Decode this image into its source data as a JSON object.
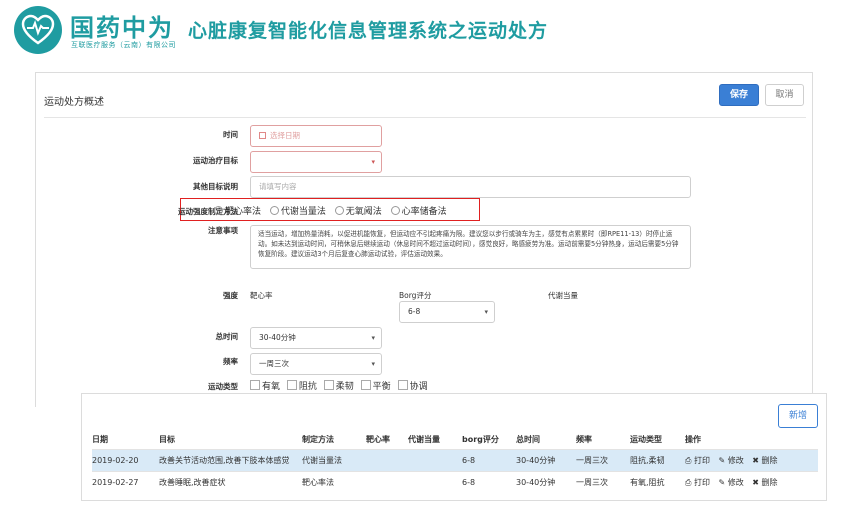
{
  "header": {
    "logo_name": "国药中为",
    "logo_sub": "互联医疗服务（云南）有限公司",
    "app_title": "心脏康复智能化信息管理系统之运动处方"
  },
  "panel": {
    "title": "运动处方概述",
    "save_label": "保存",
    "cancel_label": "取消"
  },
  "form": {
    "time_label": "时间",
    "time_placeholder": "选择日期",
    "goal_label": "运动治疗目标",
    "goal_value": "",
    "other_goal_label": "其他目标说明",
    "other_goal_placeholder": "请填写内容",
    "intensity_method_label": "运动强度制定方法",
    "intensity_methods": [
      "靶心率法",
      "代谢当量法",
      "无氧阈法",
      "心率储备法"
    ],
    "notes_label": "注意事项",
    "notes_text": "适当运动，增加热量消耗，以促进机能恢复，但运动应不引起疼痛为限。建议您以步行或骑车为主，感觉有点累累时（即RPE11-13）时停止运动。如未达到运动时间，可稍休息后继续运动（休息时间不超过运动时间），感觉良好，略感疲劳为准。运动前需要5分钟热身，运动后需要5分钟恢复阶段。建议运动3个月后复查心肺运动试验，评估运动效果。",
    "intensity_label": "强度",
    "heart_rate_label": "靶心率",
    "borg_label": "Borg评分",
    "borg_value": "6-8",
    "met_label": "代谢当量",
    "duration_label": "总时间",
    "duration_value": "30-40分钟",
    "frequency_label": "频率",
    "frequency_value": "一周三次",
    "type_label": "运动类型",
    "types": [
      "有氧",
      "阻抗",
      "柔韧",
      "平衡",
      "协调"
    ]
  },
  "table": {
    "new_label": "新增",
    "headers": [
      "日期",
      "目标",
      "制定方法",
      "靶心率",
      "代谢当量",
      "borg评分",
      "总时间",
      "频率",
      "运动类型",
      "操作"
    ],
    "rows": [
      {
        "date": "2019-02-20",
        "goal": "改善关节活动范围,改善下肢本体感觉",
        "method": "代谢当量法",
        "hr": "",
        "met": "",
        "borg": "6-8",
        "time": "30-40分钟",
        "freq": "一周三次",
        "type": "阻抗,柔韧"
      },
      {
        "date": "2019-02-27",
        "goal": "改善睡眠,改善症状",
        "method": "靶心率法",
        "hr": "",
        "met": "",
        "borg": "6-8",
        "time": "30-40分钟",
        "freq": "一周三次",
        "type": "有氧,阻抗"
      }
    ],
    "op_print": "打印",
    "op_edit": "修改",
    "op_delete": "删除"
  },
  "colors": {
    "brand": "#1f9ca1",
    "primary": "#3a7fd5",
    "highlight_border": "#e02020",
    "selected_row": "#d9eaf7"
  }
}
